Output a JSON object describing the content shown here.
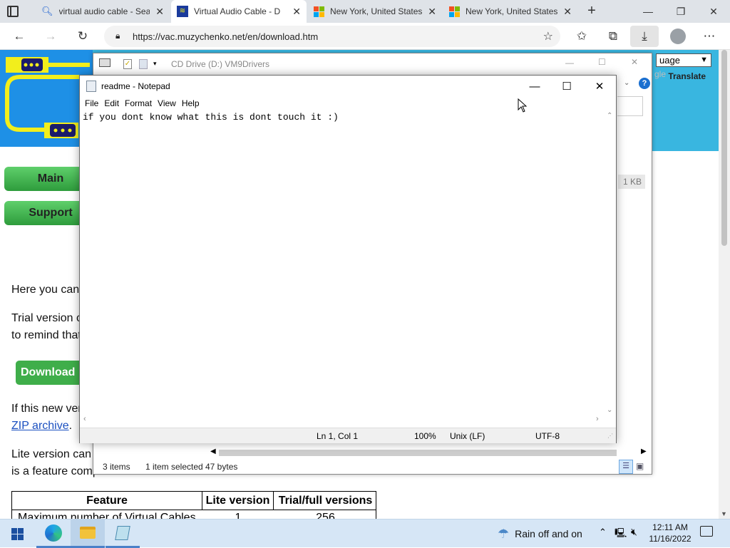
{
  "browser": {
    "tabs": [
      {
        "title": "virtual audio cable - Sea",
        "icon": "search-icon"
      },
      {
        "title": "Virtual Audio Cable - D",
        "icon": "vac-icon"
      },
      {
        "title": "New York, United States",
        "icon": "microsoft-icon"
      },
      {
        "title": "New York, United States",
        "icon": "microsoft-icon"
      }
    ],
    "url": "https://vac.muzychenko.net/en/download.htm"
  },
  "webpage": {
    "language_select": "uage",
    "translate_label": "Translate",
    "google_g": "gle",
    "nav_main": "Main",
    "nav_support": "Support",
    "download_button": "Download",
    "line1": "Here you can",
    "line2": "Trial version c",
    "line3": "to remind that",
    "line4": "If this new ver",
    "zip_link": "ZIP archive",
    "zip_dot": ".",
    "line5": "Lite version can",
    "line6": "is a feature comparison table:",
    "file_size": "1 KB",
    "table": {
      "headers": [
        "Feature",
        "Lite version",
        "Trial/full versions"
      ],
      "row1": [
        "Maximum number of Virtual Cables",
        "1",
        "256"
      ]
    }
  },
  "explorer": {
    "title": "CD Drive (D:) VM9Drivers",
    "status_items": "3 items",
    "status_selected": "1 item selected",
    "status_size": "47 bytes"
  },
  "notepad": {
    "title": "readme - Notepad",
    "menu": [
      "File",
      "Edit",
      "Format",
      "View",
      "Help"
    ],
    "content": "if you dont know what this is dont touch it :)",
    "status": {
      "position": "Ln 1, Col 1",
      "zoom": "100%",
      "line_ending": "Unix (LF)",
      "encoding": "UTF-8"
    }
  },
  "taskbar": {
    "weather": "Rain off and on",
    "time": "12:11 AM",
    "date": "11/16/2022"
  },
  "colors": {
    "tab_bar": "#dfe3e8",
    "site_blue": "#1e90e6",
    "site_yellow": "#f2ee1c",
    "green_button": "#3fae4a",
    "taskbar": "#d6e6f6"
  }
}
